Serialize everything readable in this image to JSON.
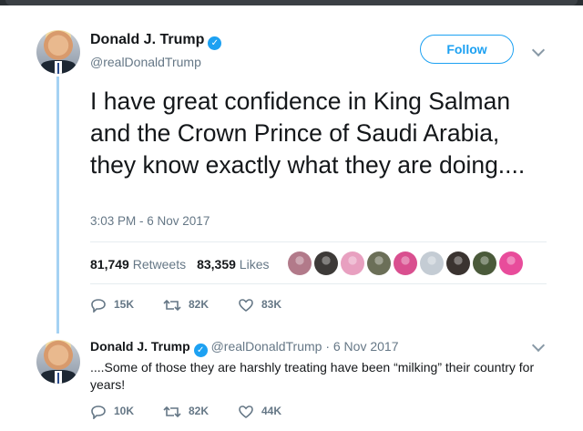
{
  "tweet": {
    "author_name": "Donald J. Trump",
    "handle": "@realDonaldTrump",
    "follow_label": "Follow",
    "text": "I have great confidence in King Salman and the Crown Prince of Saudi Arabia, they know exactly what they are doing....",
    "timestamp": "3:03 PM - 6 Nov 2017",
    "retweets_count": "81,749",
    "retweets_label": "Retweets",
    "likes_count": "83,359",
    "likes_label": "Likes",
    "likers": [
      "#b27a8a",
      "#3d3a38",
      "#e8a0c0",
      "#6b6f58",
      "#d94f8f",
      "#c4ccd4",
      "#3a3330",
      "#4a5a3a",
      "#e84c9b"
    ],
    "replies": "15K",
    "retweets_short": "82K",
    "likes_short": "83K"
  },
  "reply": {
    "author_name": "Donald J. Trump",
    "handle": "@realDonaldTrump",
    "date": "· 6 Nov 2017",
    "text": "....Some of those they are harshly treating have been “milking” their country for years!",
    "replies": "10K",
    "retweets": "82K",
    "likes": "44K"
  },
  "colors": {
    "accent": "#1da1f2",
    "thread": "#a5d2f3",
    "muted": "#657786"
  }
}
